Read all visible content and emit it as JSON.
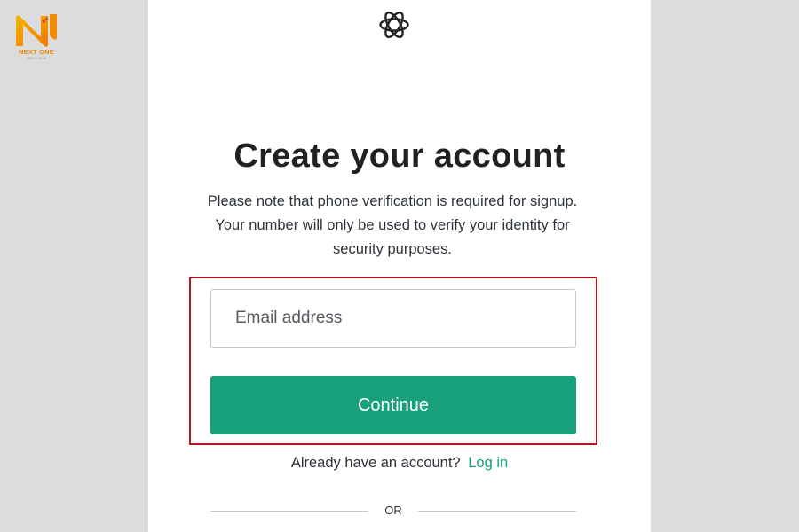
{
  "watermark": {
    "brand_name": "NEXT ONE",
    "tagline": "NEXT & NOW",
    "icon": "next-one-logo",
    "colors": {
      "primary": "#f08a00",
      "accent": "#f5b400"
    }
  },
  "signup": {
    "logo_icon": "openai-logo",
    "title": "Create your account",
    "note": "Please note that phone verification is required for signup. Your number will only be used to verify your identity for security purposes.",
    "email_input": {
      "placeholder": "Email address",
      "value": ""
    },
    "continue_label": "Continue",
    "login_prompt": "Already have an account?",
    "login_link": "Log in",
    "divider_text": "OR",
    "colors": {
      "primary_button": "#18a07a",
      "link": "#10a37f",
      "highlight_border": "#b0161d",
      "text": "#2d333a",
      "background": "#dcdcdc"
    }
  }
}
